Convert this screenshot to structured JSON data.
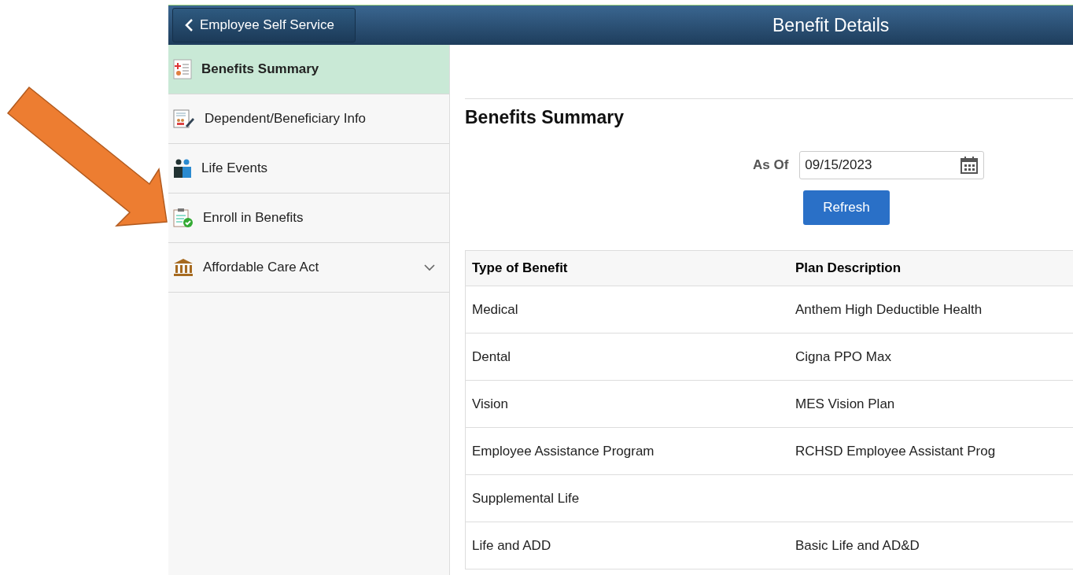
{
  "header": {
    "back_label": "Employee Self Service",
    "title": "Benefit Details"
  },
  "sidebar": {
    "items": [
      {
        "label": "Benefits Summary",
        "selected": true
      },
      {
        "label": "Dependent/Beneficiary Info",
        "selected": false
      },
      {
        "label": "Life Events",
        "selected": false
      },
      {
        "label": "Enroll in Benefits",
        "selected": false
      },
      {
        "label": "Affordable Care Act",
        "selected": false,
        "expanded": false
      }
    ]
  },
  "content": {
    "heading": "Benefits Summary",
    "as_of_label": "As Of",
    "as_of_value": "09/15/2023",
    "refresh_label": "Refresh",
    "table": {
      "columns": [
        "Type of Benefit",
        "Plan Description"
      ],
      "rows": [
        [
          "Medical",
          "Anthem High Deductible Health"
        ],
        [
          "Dental",
          "Cigna PPO Max"
        ],
        [
          "Vision",
          "MES Vision Plan"
        ],
        [
          "Employee Assistance Program",
          "RCHSD Employee Assistant Prog"
        ],
        [
          "Supplemental Life",
          ""
        ],
        [
          "Life and ADD",
          "Basic Life and AD&D"
        ]
      ]
    }
  }
}
